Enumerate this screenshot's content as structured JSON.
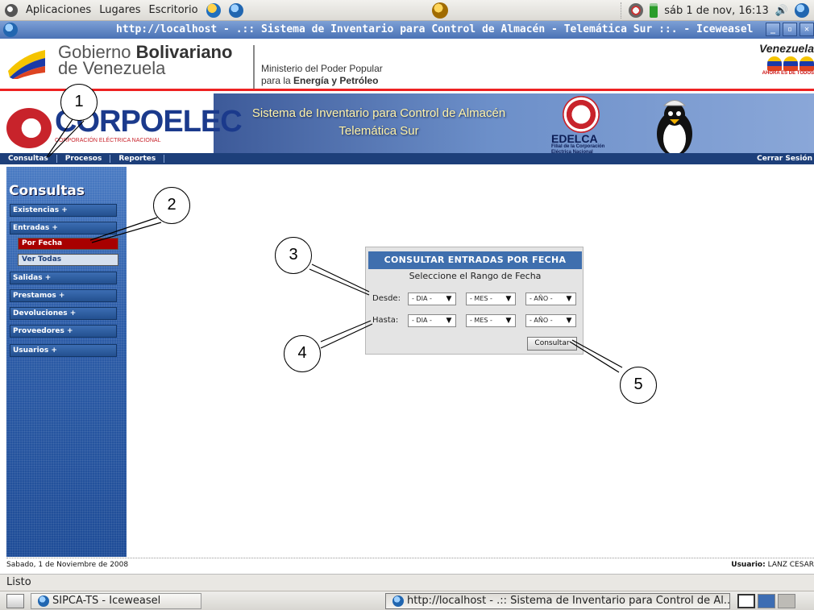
{
  "gnome_panel": {
    "menus": [
      "Aplicaciones",
      "Lugares",
      "Escritorio"
    ],
    "clock": "sáb  1 de nov, 16:13"
  },
  "window": {
    "title": "http://localhost - .:: Sistema de Inventario para Control de Almacén - Telemática Sur ::. - Iceweasel"
  },
  "header": {
    "gov_line1_prefix": "Gobierno ",
    "gov_line1_bold": "Bolivariano",
    "gov_line2": "de Venezuela",
    "ministry_line1": "Ministerio del Poder Popular",
    "ministry_line2_prefix": "para la ",
    "ministry_line2_bold": "Energía y Petróleo",
    "ven_slogan": "Venezuela",
    "ven_tagline": "AHORA ES DE TODOS"
  },
  "banner": {
    "brand": "CORPOELEC",
    "brand_sub": "CORPORACIÓN ELÉCTRICA NACIONAL",
    "title_line1": "Sistema de Inventario para Control de Almacén",
    "title_line2": "Telemática Sur",
    "edelca_name": "EDELCA",
    "edelca_sub1": "Filial de la Corporación",
    "edelca_sub2": "Eléctrica Nacional"
  },
  "nav": {
    "items": [
      "Consultas",
      "Procesos",
      "Reportes"
    ],
    "logout": "Cerrar Sesión"
  },
  "sidebar": {
    "heading": "Consultas",
    "items": [
      {
        "label": "Existencias +"
      },
      {
        "label": "Entradas +"
      },
      {
        "label": "Salidas +"
      },
      {
        "label": "Prestamos +"
      },
      {
        "label": "Devoluciones +"
      },
      {
        "label": "Proveedores +"
      },
      {
        "label": "Usuarios +"
      }
    ],
    "subitems": [
      {
        "label": "Por Fecha",
        "active": true
      },
      {
        "label": "Ver Todas",
        "active": false
      }
    ]
  },
  "form": {
    "header": "CONSULTAR ENTRADAS POR FECHA",
    "subtitle": "Seleccione el Rango de Fecha",
    "desde_label": "Desde:",
    "hasta_label": "Hasta:",
    "day_option": "- DIA -",
    "month_option": "- MES -",
    "year_option": "- AÑO -",
    "submit": "Consultar"
  },
  "callouts": [
    "1",
    "2",
    "3",
    "4",
    "5"
  ],
  "page_status": {
    "date": "Sabado, 1 de Noviembre de 2008",
    "user_label": "Usuario:",
    "user_value": "LANZ CESAR"
  },
  "browser_status": "Listo",
  "taskbar": {
    "task1": "SIPCA-TS - Iceweasel",
    "task2": "http://localhost - .:: Sistema de Inventario para Control de Al..."
  },
  "colors": {
    "nav_blue": "#1d3f7a",
    "form_header": "#3f6fae",
    "active_item": "#a80000",
    "banner_title": "#fff3a8"
  }
}
